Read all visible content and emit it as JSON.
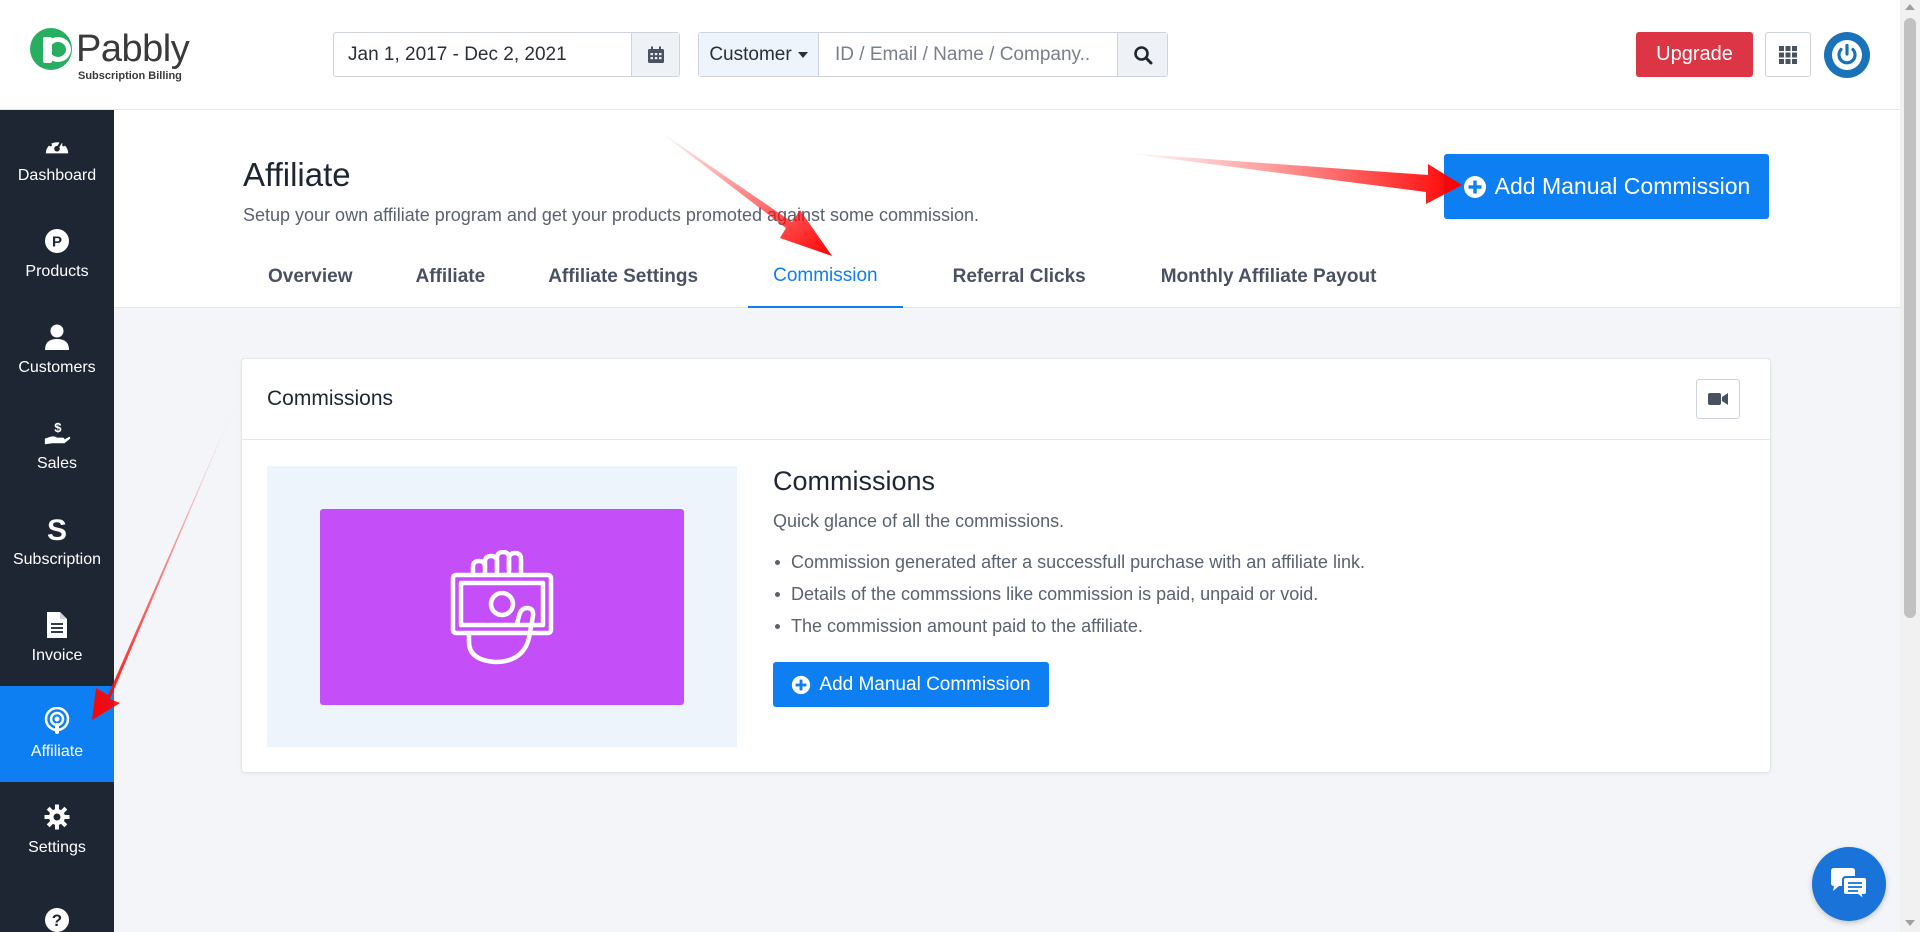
{
  "brand": {
    "name": "Pabbly",
    "subtitle": "Subscription Billing",
    "color": "#27ae60"
  },
  "header": {
    "date_range": "Jan 1, 2017 - Dec 2, 2021",
    "search_type": "Customer",
    "search_placeholder": "ID / Email / Name / Company..",
    "upgrade_label": "Upgrade"
  },
  "sidebar": {
    "items": [
      {
        "label": "Dashboard",
        "icon": "gauge-icon"
      },
      {
        "label": "Products",
        "icon": "p-circle-icon"
      },
      {
        "label": "Customers",
        "icon": "user-icon"
      },
      {
        "label": "Sales",
        "icon": "hand-dollar-icon"
      },
      {
        "label": "Subscription",
        "icon": "s-icon"
      },
      {
        "label": "Invoice",
        "icon": "file-icon"
      },
      {
        "label": "Affiliate",
        "icon": "podcast-icon",
        "active": true
      },
      {
        "label": "Settings",
        "icon": "gear-icon"
      },
      {
        "label": "",
        "icon": "question-icon"
      }
    ]
  },
  "page": {
    "title": "Affiliate",
    "subtitle": "Setup your own affiliate program and get your products promoted against some commission.",
    "add_button": "Add Manual Commission",
    "tabs": [
      {
        "label": "Overview"
      },
      {
        "label": "Affiliate"
      },
      {
        "label": "Affiliate Settings"
      },
      {
        "label": "Commission",
        "active": true
      },
      {
        "label": "Referral Clicks"
      },
      {
        "label": "Monthly Affiliate Payout"
      }
    ]
  },
  "card": {
    "title": "Commissions",
    "info_title": "Commissions",
    "info_sub": "Quick glance of all the commissions.",
    "bullets": [
      "Commission generated after a successfull purchase with an affiliate link.",
      "Details of the commssions like commission is paid, unpaid or void.",
      "The commission amount paid to the affiliate."
    ],
    "add_button": "Add Manual Commission"
  },
  "colors": {
    "primary": "#0d7ff2",
    "danger": "#dc3545",
    "sidebar": "#1f2633",
    "illustration": "#c44ef7"
  }
}
